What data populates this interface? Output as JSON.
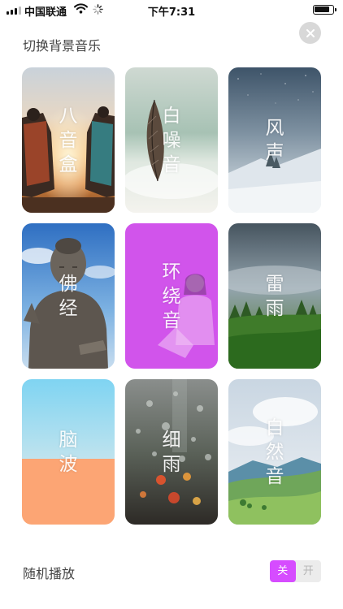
{
  "status_bar": {
    "carrier": "中国联通",
    "time": "下午7:31",
    "icons": [
      "signal-icon",
      "wifi-icon",
      "loading-spinner-icon",
      "battery-icon"
    ]
  },
  "header": {
    "title": "切换背景音乐",
    "close_icon": "close-icon"
  },
  "tiles": [
    {
      "label": "八音盒",
      "scene": "two chairs facing a sunset"
    },
    {
      "label": "白噪音",
      "scene": "feather on misty water"
    },
    {
      "label": "风声",
      "scene": "snowy mountain under starry sky"
    },
    {
      "label": "佛经",
      "scene": "bronze buddha statue under blue sky"
    },
    {
      "label": "环绕音",
      "scene": "girl on magenta background"
    },
    {
      "label": "雷雨",
      "scene": "misty green forest"
    },
    {
      "label": "脑波",
      "scene": "blue and orange gradient"
    },
    {
      "label": "细雨",
      "scene": "raindrops on window with city lights"
    },
    {
      "label": "自然音",
      "scene": "green hills and clouds"
    }
  ],
  "shuffle": {
    "label": "随机播放",
    "off_label": "关",
    "on_label": "开",
    "active": "off"
  },
  "colors": {
    "accent": "#d64cff",
    "toggle_inactive_bg": "#ececec",
    "close_button_bg": "#d8d8d8"
  }
}
